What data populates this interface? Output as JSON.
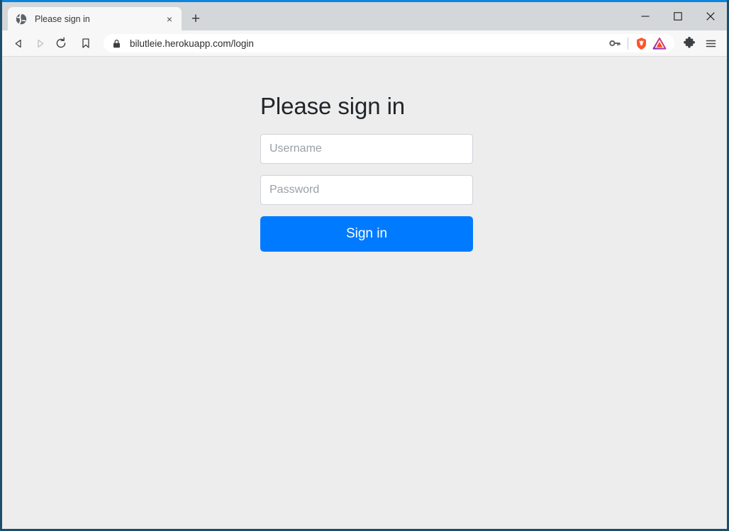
{
  "browser": {
    "tab": {
      "title": "Please sign in",
      "favicon": "globe-icon",
      "close_label": "×"
    },
    "newtab_label": "+",
    "window_controls": {
      "minimize": "—",
      "maximize": "□",
      "close": "✕"
    },
    "toolbar": {
      "back": "back-arrow-icon",
      "forward": "forward-arrow-icon",
      "reload": "reload-icon",
      "bookmark": "bookmark-icon",
      "url": "bilutleie.herokuapp.com/login",
      "security_icon": "lock-icon",
      "password_manager": "key-icon",
      "brave_shields": "brave-lion-icon",
      "brave_rewards": "bat-triangle-icon",
      "extensions": "puzzle-piece-icon",
      "menu": "hamburger-menu-icon"
    }
  },
  "page": {
    "heading": "Please sign in",
    "username": {
      "placeholder": "Username",
      "value": ""
    },
    "password": {
      "placeholder": "Password",
      "value": ""
    },
    "submit_label": "Sign in"
  },
  "colors": {
    "accent_blue": "#0b84dd",
    "button_blue": "#007bff",
    "page_bg": "#ededed",
    "tabstrip_bg": "#d4d7da",
    "window_border": "#1d4f6c"
  }
}
